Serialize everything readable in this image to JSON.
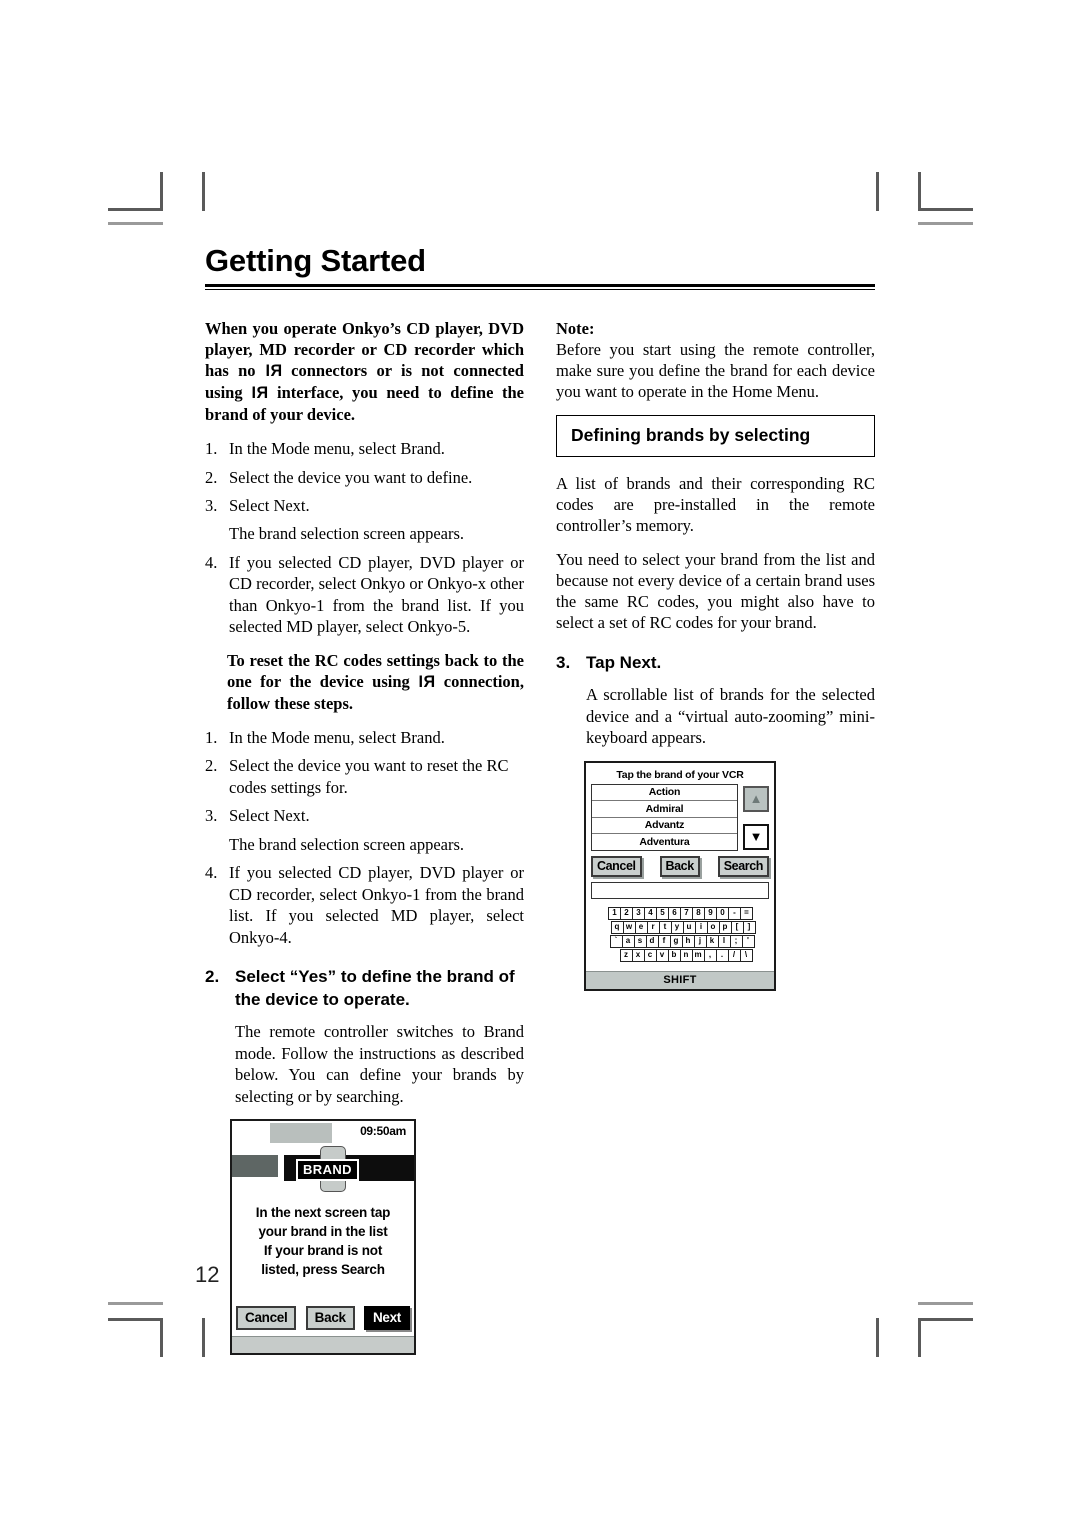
{
  "document": {
    "page_number": "12",
    "chapter_title": "Getting Started"
  },
  "left_column": {
    "intro_bold_part1": "When you operate Onkyo’s CD player, DVD player, MD recorder or CD recorder which has no ",
    "ri_symbol": "RI",
    "intro_bold_part2": " connectors or is not connected using ",
    "intro_bold_part3": " interface, you need to define the brand of your device.",
    "steps_a": [
      {
        "num": "1.",
        "text": "In the Mode menu, select Brand."
      },
      {
        "num": "2.",
        "text": "Select the device you want to define."
      },
      {
        "num": "3.",
        "text": "Select Next."
      }
    ],
    "steps_a_note": "The brand selection screen appears.",
    "steps_a_last": {
      "num": "4.",
      "text": "If you selected CD player, DVD player or CD recorder, select Onkyo or Onkyo-x other than Onkyo-1 from the brand list. If you selected MD player, select Onkyo-5."
    },
    "reset_bold_part1": "To reset the RC codes settings back to the one for the device using ",
    "reset_bold_part2": " connection, follow these steps.",
    "steps_b": [
      {
        "num": "1.",
        "text": "In the Mode menu, select Brand."
      },
      {
        "num": "2.",
        "text": "Select the device you want to reset the RC codes settings for."
      },
      {
        "num": "3.",
        "text": "Select Next."
      }
    ],
    "steps_b_note": "The brand selection screen appears.",
    "steps_b_last": {
      "num": "4.",
      "text": "If you selected CD player, DVD player or CD recorder, select Onkyo-1 from the brand list. If you selected MD player, select Onkyo-4."
    },
    "section2": {
      "num": "2.",
      "heading": "Select “Yes” to define the brand of the device to operate.",
      "body": "The remote controller switches to Brand mode. Follow the instructions as described below. You can define your brands by selecting or by searching."
    }
  },
  "right_column": {
    "note_label": "Note:",
    "note_body": "Before you start using the remote controller, make sure you define the brand for each device you want to operate in the Home Menu.",
    "section_heading": "Defining brands by selecting",
    "para1": "A list of brands and their corresponding RC codes are pre-installed in the remote controller’s memory.",
    "para2": "You need to select your brand from the list and because not every device of a certain brand uses the same RC codes, you might also have to select a set of RC codes for your brand.",
    "section3": {
      "num": "3.",
      "heading": "Tap Next.",
      "body": "A scrollable list of brands for the selected device and a “virtual auto-zooming” mini-keyboard appears."
    }
  },
  "figure_brand_screen": {
    "time": "09:50am",
    "mode_label": "BRAND",
    "message_lines": [
      "In the next screen tap",
      "your brand in the list",
      "If your brand is not",
      "listed, press Search"
    ],
    "buttons": [
      {
        "label": "Cancel",
        "style": "normal"
      },
      {
        "label": "Back",
        "style": "normal"
      },
      {
        "label": "Next",
        "style": "highlighted"
      }
    ]
  },
  "figure_brand_list": {
    "title": "Tap the brand of your VCR",
    "brands": [
      "Action",
      "Admiral",
      "Advantz",
      "Adventura"
    ],
    "scroll_up_icon": "arrow-up",
    "scroll_down_icon": "arrow-down",
    "buttons": [
      "Cancel",
      "Back",
      "Search"
    ],
    "search_field_value": "",
    "keyboard_rows": [
      [
        "1",
        "2",
        "3",
        "4",
        "5",
        "6",
        "7",
        "8",
        "9",
        "0",
        "-",
        "="
      ],
      [
        "q",
        "w",
        "e",
        "r",
        "t",
        "y",
        "u",
        "i",
        "o",
        "p",
        "[",
        "]"
      ],
      [
        "`",
        "a",
        "s",
        "d",
        "f",
        "g",
        "h",
        "j",
        "k",
        "l",
        ";",
        "'"
      ],
      [
        "z",
        "x",
        "c",
        "v",
        "b",
        "n",
        "m",
        ",",
        ".",
        "/",
        "\\"
      ]
    ],
    "shift_label": "SHIFT"
  },
  "colors": {
    "ink": "#000000",
    "lcd_gray": "#c6cbc9",
    "lcd_dark_gray": "#5e6664",
    "crop_mark": "#5a5a5a"
  }
}
